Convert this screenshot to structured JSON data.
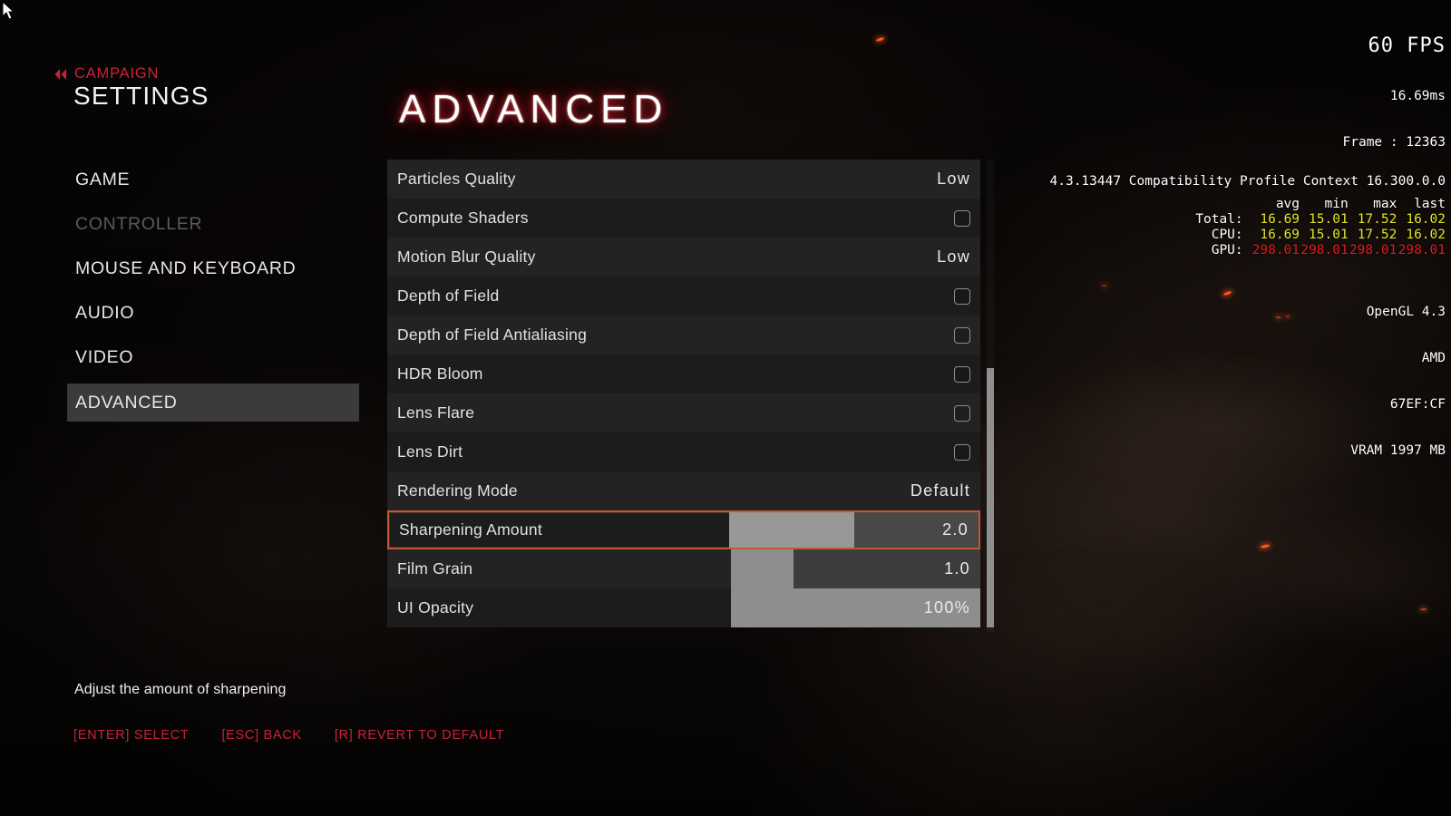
{
  "breadcrumb": {
    "back_icon": "double-chevron-left-icon",
    "label": "CAMPAIGN"
  },
  "page_title": "SETTINGS",
  "section_title": "ADVANCED",
  "sidebar": {
    "items": [
      {
        "label": "GAME",
        "state": "normal"
      },
      {
        "label": "CONTROLLER",
        "state": "disabled"
      },
      {
        "label": "MOUSE AND KEYBOARD",
        "state": "normal"
      },
      {
        "label": "AUDIO",
        "state": "normal"
      },
      {
        "label": "VIDEO",
        "state": "normal"
      },
      {
        "label": "ADVANCED",
        "state": "selected"
      }
    ]
  },
  "settings": {
    "rows": [
      {
        "label": "Particles Quality",
        "type": "value",
        "value": "Low"
      },
      {
        "label": "Compute Shaders",
        "type": "checkbox",
        "checked": false
      },
      {
        "label": "Motion Blur Quality",
        "type": "value",
        "value": "Low"
      },
      {
        "label": "Depth of Field",
        "type": "checkbox",
        "checked": false
      },
      {
        "label": "Depth of Field Antialiasing",
        "type": "checkbox",
        "checked": false
      },
      {
        "label": "HDR Bloom",
        "type": "checkbox",
        "checked": false
      },
      {
        "label": "Lens Flare",
        "type": "checkbox",
        "checked": false
      },
      {
        "label": "Lens Dirt",
        "type": "checkbox",
        "checked": false
      },
      {
        "label": "Rendering Mode",
        "type": "value",
        "value": "Default"
      },
      {
        "label": "Sharpening Amount",
        "type": "slider",
        "value": "2.0",
        "fill_percent": 50,
        "selected": true
      },
      {
        "label": "Film Grain",
        "type": "slider",
        "value": "1.0",
        "fill_percent": 25
      },
      {
        "label": "UI Opacity",
        "type": "slider",
        "value": "100%",
        "fill_percent": 100
      }
    ]
  },
  "footer": {
    "hint": "Adjust the amount of sharpening",
    "keys": [
      "[ENTER] SELECT",
      "[ESC] BACK",
      "[R] REVERT TO DEFAULT"
    ]
  },
  "overlay": {
    "fps": "60 FPS",
    "frametime": "16.69ms",
    "frame": "Frame : 12363",
    "columns": [
      "avg",
      "min",
      "max",
      "last"
    ],
    "rows": [
      {
        "name": "Total:",
        "values": [
          "16.69",
          "15.01",
          "17.52",
          "16.02"
        ],
        "color": "#e3e327"
      },
      {
        "name": "CPU:",
        "values": [
          "16.69",
          "15.01",
          "17.52",
          "16.02"
        ],
        "color": "#e3e327"
      },
      {
        "name": "GPU:",
        "values": [
          "298.01",
          "298.01",
          "298.01",
          "298.01"
        ],
        "color": "#e01b1b"
      }
    ],
    "api": "OpenGL 4.3",
    "vendor": "AMD",
    "device_id": "67EF:CF",
    "vram": "VRAM 1997 MB",
    "context": "4.3.13447 Compatibility Profile Context 16.300.0.0"
  },
  "colors": {
    "accent_red": "#c9223a",
    "selection_border": "#bd5a34",
    "slider_fill": "#8e8e8e",
    "sidebar_selected_bg": "#3b3b3b"
  }
}
